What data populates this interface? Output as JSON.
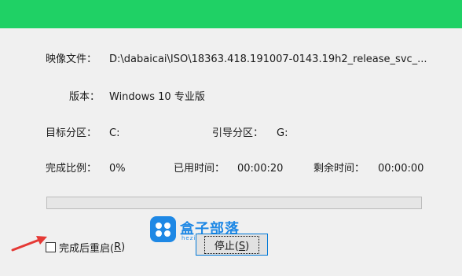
{
  "colors": {
    "titlebar": "#1fd165",
    "progress_fill": "#06b025",
    "arrow": "#e53935",
    "watermark": "#1e88e5"
  },
  "fields": {
    "image_file": {
      "label": "映像文件：",
      "value": "D:\\dabaicai\\ISO\\18363.418.191007-0143.19h2_release_svc_..."
    },
    "version": {
      "label": "版本：",
      "value": "Windows 10 专业版"
    },
    "target_partition": {
      "label": "目标分区：",
      "value": "C:"
    },
    "boot_partition": {
      "label": "引导分区：",
      "value": "G:"
    },
    "completion": {
      "label": "完成比例：",
      "value": "0%"
    },
    "elapsed": {
      "label": "已用时间：",
      "value": "00:00:20"
    },
    "remaining": {
      "label": "剩余时间：",
      "value": "00:00:00"
    }
  },
  "progress": {
    "fraction": 0.0
  },
  "restart_checkbox": {
    "label": "完成后重启(",
    "accel": "R",
    "suffix": ")",
    "checked": false
  },
  "stop_button": {
    "label": "停止(",
    "accel": "S",
    "suffix": ")"
  },
  "watermark": {
    "title": "盒子部落",
    "subtitle": "hezibuluo.com",
    "icon": "logo-icon"
  },
  "annotation": {
    "icon": "red-arrow-icon"
  }
}
